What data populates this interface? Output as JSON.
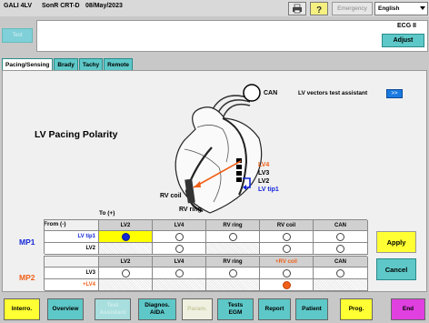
{
  "header": {
    "patient": "GALI 4LV",
    "device": "SonR CRT-D",
    "date": "08/May/2023",
    "emergency_label": "Emergency",
    "language": "English"
  },
  "ecg": {
    "test_label": "Test",
    "lead_label": "ECG II",
    "adjust_label": "Adjust"
  },
  "tabs": [
    {
      "label": "Pacing/Sensing",
      "active": true
    },
    {
      "label": "Brady",
      "active": false
    },
    {
      "label": "Tachy",
      "active": false
    },
    {
      "label": "Remote",
      "active": false
    }
  ],
  "main": {
    "title": "LV Pacing Polarity",
    "can_label": "CAN",
    "lv_vectors_label": "LV  vectors test assistant",
    "lv_vectors_button": ">>",
    "heart_labels": {
      "lv4": "LV4",
      "lv3": "LV3",
      "lv2": "LV2",
      "lvtip1": "LV tip1",
      "rv_coil": "RV coil",
      "rv_ring": "RV ring"
    },
    "to_label": "To (+)",
    "from_label": "From (-)",
    "mp1_label": "MP1",
    "mp2_label": "MP2",
    "mp1_headers": [
      "LV2",
      "LV4",
      "RV ring",
      "RV coil",
      "CAN"
    ],
    "mp1_rows": [
      "LV tip1",
      "LV2"
    ],
    "mp2_headers": [
      "LV2",
      "LV4",
      "RV ring",
      "+RV coil",
      "CAN"
    ],
    "mp2_rows": [
      "LV3",
      "+LV4"
    ],
    "apply_label": "Apply",
    "cancel_label": "Cancel"
  },
  "footer": {
    "buttons": [
      "Interro.",
      "Overview",
      "Test\nAssistant",
      "Diagnos.\nAIDA",
      "Param.",
      "Tests\nEGM",
      "Report",
      "Patient",
      "Prog.",
      "End"
    ]
  },
  "colors": {
    "accent": "#5ec8c8",
    "selected_blue": "#1428d8",
    "selected_orange": "#f06018",
    "highlight_yellow": "#ffff00",
    "end_magenta": "#e040e0"
  }
}
